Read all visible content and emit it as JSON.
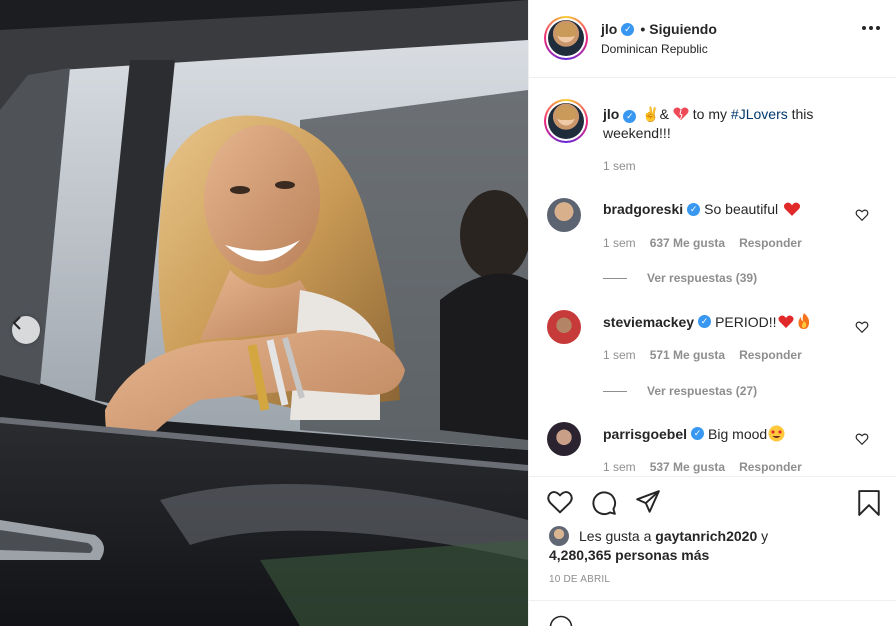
{
  "post": {
    "username": "jlo",
    "follow_status": "Siguiendo",
    "location": "Dominican Republic"
  },
  "caption": {
    "username": "jlo",
    "text_before": "✌️&",
    "text_middle": "to my",
    "hashtag": "#JLovers",
    "text_after": "this weekend!!!",
    "time": "1 sem"
  },
  "comments": [
    {
      "username": "bradgoreski",
      "text": "So beautiful",
      "emoji": "heart",
      "time": "1 sem",
      "likes": "637 Me gusta",
      "reply": "Responder",
      "view_replies": "Ver respuestas (39)"
    },
    {
      "username": "steviemackey",
      "text": "PERIOD!!",
      "emoji": "heart-fire",
      "time": "1 sem",
      "likes": "571 Me gusta",
      "reply": "Responder",
      "view_replies": "Ver respuestas (27)"
    },
    {
      "username": "parrisgoebel",
      "text": "Big mood",
      "emoji": "heart-eyes",
      "time": "1 sem",
      "likes": "537 Me gusta",
      "reply": "Responder"
    }
  ],
  "likes": {
    "prefix": "Les gusta a",
    "user": "gaytanrich2020",
    "conj": "y",
    "others": "4,280,365 personas más"
  },
  "date": "10 DE ABRIL",
  "colors": {
    "verified": "#3897f0",
    "heart": "#ed4956",
    "secondary": "#8e8e8e"
  }
}
